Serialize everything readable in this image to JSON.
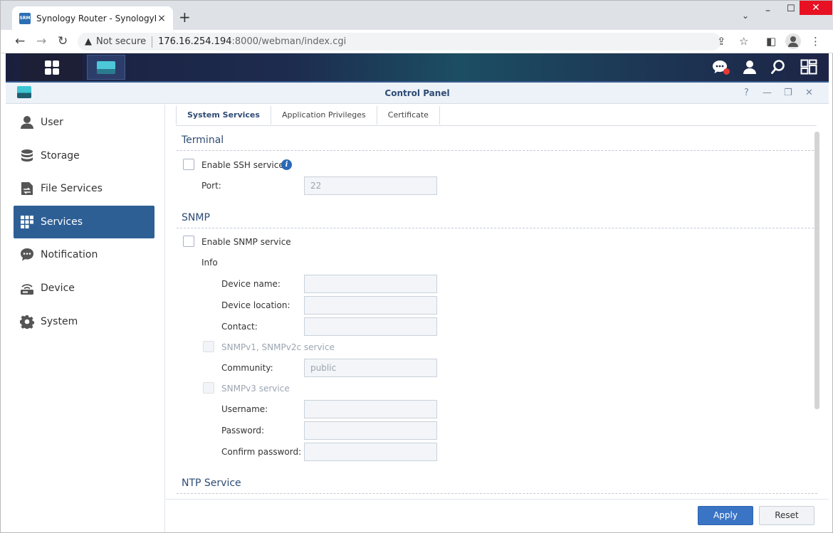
{
  "browser": {
    "tab_title": "Synology Router - SynologyRouter",
    "favicon_text": "SRM",
    "not_secure": "Not secure",
    "url_host": "176.16.254.194",
    "url_path": ":8000/webman/index.cgi"
  },
  "window": {
    "title": "Control Panel"
  },
  "sidebar": {
    "items": [
      {
        "label": "User",
        "icon": "user-icon"
      },
      {
        "label": "Storage",
        "icon": "storage-icon"
      },
      {
        "label": "File Services",
        "icon": "file-services-icon"
      },
      {
        "label": "Services",
        "icon": "services-icon",
        "active": true
      },
      {
        "label": "Notification",
        "icon": "notification-icon"
      },
      {
        "label": "Device",
        "icon": "device-icon"
      },
      {
        "label": "System",
        "icon": "system-icon"
      }
    ]
  },
  "tabs": [
    {
      "label": "System Services",
      "active": true
    },
    {
      "label": "Application Privileges"
    },
    {
      "label": "Certificate"
    }
  ],
  "terminal": {
    "title": "Terminal",
    "enable_ssh": "Enable SSH service",
    "enable_ssh_checked": false,
    "port_label": "Port:",
    "port_value": "22"
  },
  "snmp": {
    "title": "SNMP",
    "enable_snmp": "Enable SNMP service",
    "enable_snmp_checked": false,
    "info_label": "Info",
    "device_name_label": "Device name:",
    "device_name_value": "",
    "device_location_label": "Device location:",
    "device_location_value": "",
    "contact_label": "Contact:",
    "contact_value": "",
    "v1v2c_label": "SNMPv1, SNMPv2c service",
    "community_label": "Community:",
    "community_value": "public",
    "v3_label": "SNMPv3 service",
    "username_label": "Username:",
    "username_value": "",
    "password_label": "Password:",
    "password_value": "",
    "confirm_password_label": "Confirm password:",
    "confirm_password_value": ""
  },
  "ntp": {
    "title": "NTP Service"
  },
  "footer": {
    "apply_label": "Apply",
    "reset_label": "Reset"
  },
  "colors": {
    "accent": "#2d5f95",
    "apply": "#3a74c4",
    "section_title": "#2e4b74"
  }
}
